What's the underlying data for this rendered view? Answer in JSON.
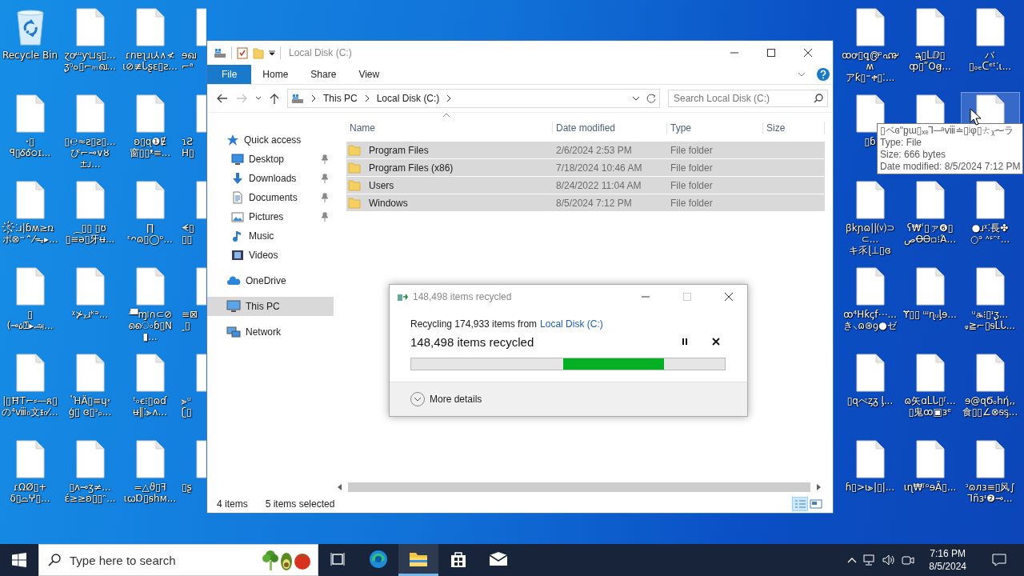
{
  "desktop": {
    "left_icons": [
      {
        "kind": "recycle-bin",
        "label": "Recycle Bin",
        "hovered": false
      },
      {
        "kind": "file",
        "label": "ꞏ▯\nꟼ▯ᎴᎴ੦ɪ...",
        "hovered": false
      },
      {
        "kind": "file",
        "label": "ৎ҉⁚ɹ|ɓʍ≥ռ\nポ⊗⁼⌃⁄ᯓ▸...",
        "hovered": false
      },
      {
        "kind": "file",
        "label": "▯\n(⊸ዕ⍰▸அ...",
        "hovered": false
      },
      {
        "kind": "file",
        "label": "|▯ĦT⌐⸗—ጸ▯\nの⁴ⅷ₀文ᵻ₀⁄...",
        "hovered": false
      },
      {
        "kind": "file",
        "label": "ɾΩØ▯+\nδ▯⌓ⵖ▯...",
        "hovered": false
      },
      {
        "kind": "file",
        "label": "ɀꝍᵚƴ⊔ᶊ▯...\nᶚᵑ๐▯⌐ₘഖ...",
        "hovered": false
      },
      {
        "kind": "file",
        "label": "▯℮≈ƨ▯ƨ▯...\nぴ⌐⊸∨ȣ±ᴊ...",
        "hovered": false
      },
      {
        "kind": "file",
        "label": "⁔▯▯ ▯ʊ\n▯≡ǝ▯牙ʉ...",
        "hovered": false
      },
      {
        "kind": "file",
        "label": "ᵡ⊁ᵪɹᵏᵊ...",
        "hovered": false
      },
      {
        "kind": "file",
        "label": "ʽΉÄ▯≡ɥ৽\nǵ▯ ɞ▯ᵌₚ...",
        "hovered": false
      },
      {
        "kind": "file",
        "label": "▯ʌ⊸ʒ≠...\nέ≥≥ʚ▯▯ᵔ...",
        "hovered": false
      },
      {
        "kind": "file",
        "label": "ɾnɐʅɹɩ⅄∧≮\nɩ⊘≢ᒐʂɛ▯ƨ...",
        "hovered": false
      },
      {
        "kind": "file",
        "label": "ʚ▯ɋ❶Ɇ\n窗▯▯ᵜ≡...",
        "hovered": false
      },
      {
        "kind": "file",
        "label": "∏\nᵋᴖɷ▯◯ᵒ...",
        "hovered": false
      },
      {
        "kind": "file",
        "label": "ʴ▀ɱ৷∩⊂⊘\nൈ৹ɓ▯N▮...",
        "hovered": false
      },
      {
        "kind": "file",
        "label": "ᵗ৹ꞓ⁝▯ɷɗ\nʉ‖⁚⪢ᴧ...",
        "hovered": false
      },
      {
        "kind": "file",
        "label": "=△ϑ▯ꟻ\nɩꞷⱰ▯ꞩhм...",
        "hovered": false
      },
      {
        "kind": "partial-file",
        "label": "ɘഖ\n⌐ᵃ",
        "hovered": false
      },
      {
        "kind": "partial-file",
        "label": "ɿƧ\nH▯",
        "hovered": false
      },
      {
        "kind": "partial-file",
        "label": "ᗛ▯\n▯▯",
        "hovered": false
      },
      {
        "kind": "partial-file",
        "label": "≡⊠\nꞈ▯",
        "hovered": false
      },
      {
        "kind": "partial-file",
        "label": "⪢ᵘ\nʗ▯",
        "hovered": false
      },
      {
        "kind": "partial-file",
        "label": "▯ʂ",
        "hovered": false
      }
    ],
    "right_icons": [
      {
        "kind": "file",
        "label": "ꝏꝍ▯ꝗ൫ᵖ൷ʍ\nアƙ▯⁼ቀ▯⁚...",
        "hovered": false
      },
      {
        "kind": "file",
        "label": "▯ɓ",
        "hovered": false
      },
      {
        "kind": "file",
        "label": "ꞵkɲɷ||⒱⊃⊂...\nキ乑ɭ⊥▯ɞ",
        "hovered": false
      },
      {
        "kind": "file",
        "label": "ꝏ⁴Hƙꞔf⋯...\nき⸜ɷ⊛ꝯ●ゼ",
        "hovered": false
      },
      {
        "kind": "file",
        "label": "▯ɋぺᶎᵹ ᶅ...",
        "hovered": false
      },
      {
        "kind": "file",
        "label": "ɦ▯>ɩ⪢|▯|...",
        "hovered": false
      },
      {
        "kind": "file",
        "label": "ᶕ▯ᒪⅅ▯\nȹ▯ʺOꞡ...",
        "hovered": false
      },
      {
        "kind": "file",
        "hovered": false
      },
      {
        "kind": "file",
        "label": "ʕ₩ʿ▯ァ❻▯\nصꝊᎾ▫⁝Ά...",
        "hovered": false
      },
      {
        "kind": "file",
        "label": "Ɏ▯▯ ᵚɳᵤᶅɘ...",
        "hovered": false
      },
      {
        "kind": "file",
        "label": "ɷ矢ɑᒪᒐ▯ᶴ...\n▯鬼ꝏ▣ᴈᵉ",
        "hovered": false
      },
      {
        "kind": "file",
        "label": "ɩɳ₩ᶴᵒɘÃ▯...",
        "hovered": false
      },
      {
        "kind": "file",
        "label": "バ\n▯ₒₑᑕᵉᵗ⁚ɩ...",
        "hovered": false
      },
      {
        "kind": "file",
        "hovered": true
      },
      {
        "kind": "file",
        "label": "●ɹᵡ⁚長✤\n○ᵊ ᶺᶝᵔᵋ...",
        "hovered": false
      },
      {
        "kind": "file",
        "label": "ᵘ௲⁝▯ᶧᶚ...\nᵩ≧⌐▯ᵴᒪᒐ...",
        "hovered": false
      },
      {
        "kind": "file",
        "label": "ɘ@ɋϬₒhή‚‚\n食▯▯∠⊗ᵴᶊ...",
        "hovered": false
      },
      {
        "kind": "file",
        "label": "ᵓɷᴫɜ≡▯风∫\n⅂ñɜᶧ❷⊸...",
        "hovered": false
      }
    ]
  },
  "explorer": {
    "title": "Local Disk (C:)",
    "ribbon_tabs": [
      {
        "label": "File",
        "kind": "menu"
      },
      {
        "label": "Home",
        "kind": "tab"
      },
      {
        "label": "Share",
        "kind": "tab"
      },
      {
        "label": "View",
        "kind": "tab"
      }
    ],
    "forward_disabled": true,
    "breadcrumbs": [
      "This PC",
      "Local Disk (C:)"
    ],
    "search": {
      "placeholder": "Search Local Disk (C:)"
    },
    "nav": [
      {
        "label": "Quick access",
        "kind": "star",
        "selected": false,
        "children": [
          {
            "label": "Desktop",
            "kind": "desktop",
            "pinned": true,
            "selected": false
          },
          {
            "label": "Downloads",
            "kind": "downloads",
            "pinned": true,
            "selected": false
          },
          {
            "label": "Documents",
            "kind": "documents",
            "pinned": true,
            "selected": false
          },
          {
            "label": "Pictures",
            "kind": "pictures",
            "pinned": true,
            "selected": false
          },
          {
            "label": "Music",
            "kind": "music",
            "pinned": false,
            "selected": false
          },
          {
            "label": "Videos",
            "kind": "videos",
            "pinned": false,
            "selected": false
          }
        ]
      },
      {
        "label": "OneDrive",
        "kind": "cloud",
        "selected": false
      },
      {
        "label": "This PC",
        "kind": "pc",
        "selected": true
      },
      {
        "label": "Network",
        "kind": "network",
        "selected": false
      }
    ],
    "columns": [
      "Name",
      "Date modified",
      "Type",
      "Size"
    ],
    "rows": [
      {
        "name": "Program Files",
        "date": "2/6/2024 2:53 PM",
        "type": "File folder",
        "selected": true
      },
      {
        "name": "Program Files (x86)",
        "date": "7/18/2024 10:46 AM",
        "type": "File folder",
        "selected": true
      },
      {
        "name": "Users",
        "date": "8/24/2022 11:04 AM",
        "type": "File folder",
        "selected": true
      },
      {
        "name": "Windows",
        "date": "8/5/2024 7:12 PM",
        "type": "File folder",
        "selected": true
      }
    ],
    "status": {
      "count": "4 items",
      "selection": "5 items selected"
    },
    "view_modes": [
      {
        "kind": "details",
        "selected": true
      },
      {
        "kind": "large-icons",
        "selected": false
      }
    ]
  },
  "dialog": {
    "title": "148,498 items recycled",
    "operation": "Recycling 174,933 items from",
    "source_link": "Local Disk (C:)",
    "progress_text": "148,498 items recycled",
    "progress": {
      "indeterminate": true
    },
    "details_label": "More details"
  },
  "tooltip": {
    "lines": [
      "▯ベɞʺᶈɯ▯ₓₑ⅂─ᵃⅷ≐▯ʲφ▯ㄊᵪ⁓ラ",
      "Type: File",
      "Size: 666 bytes",
      "Date modified: 8/5/2024 7:12 PM"
    ]
  },
  "taskbar": {
    "search_placeholder": "Type here to search",
    "apps": [
      {
        "kind": "task-view",
        "active": false
      },
      {
        "kind": "edge",
        "active": false
      },
      {
        "kind": "explorer",
        "active": true
      },
      {
        "kind": "store",
        "active": false
      },
      {
        "kind": "mail",
        "active": false
      }
    ],
    "time": "7:16 PM",
    "date": "8/5/2024"
  }
}
